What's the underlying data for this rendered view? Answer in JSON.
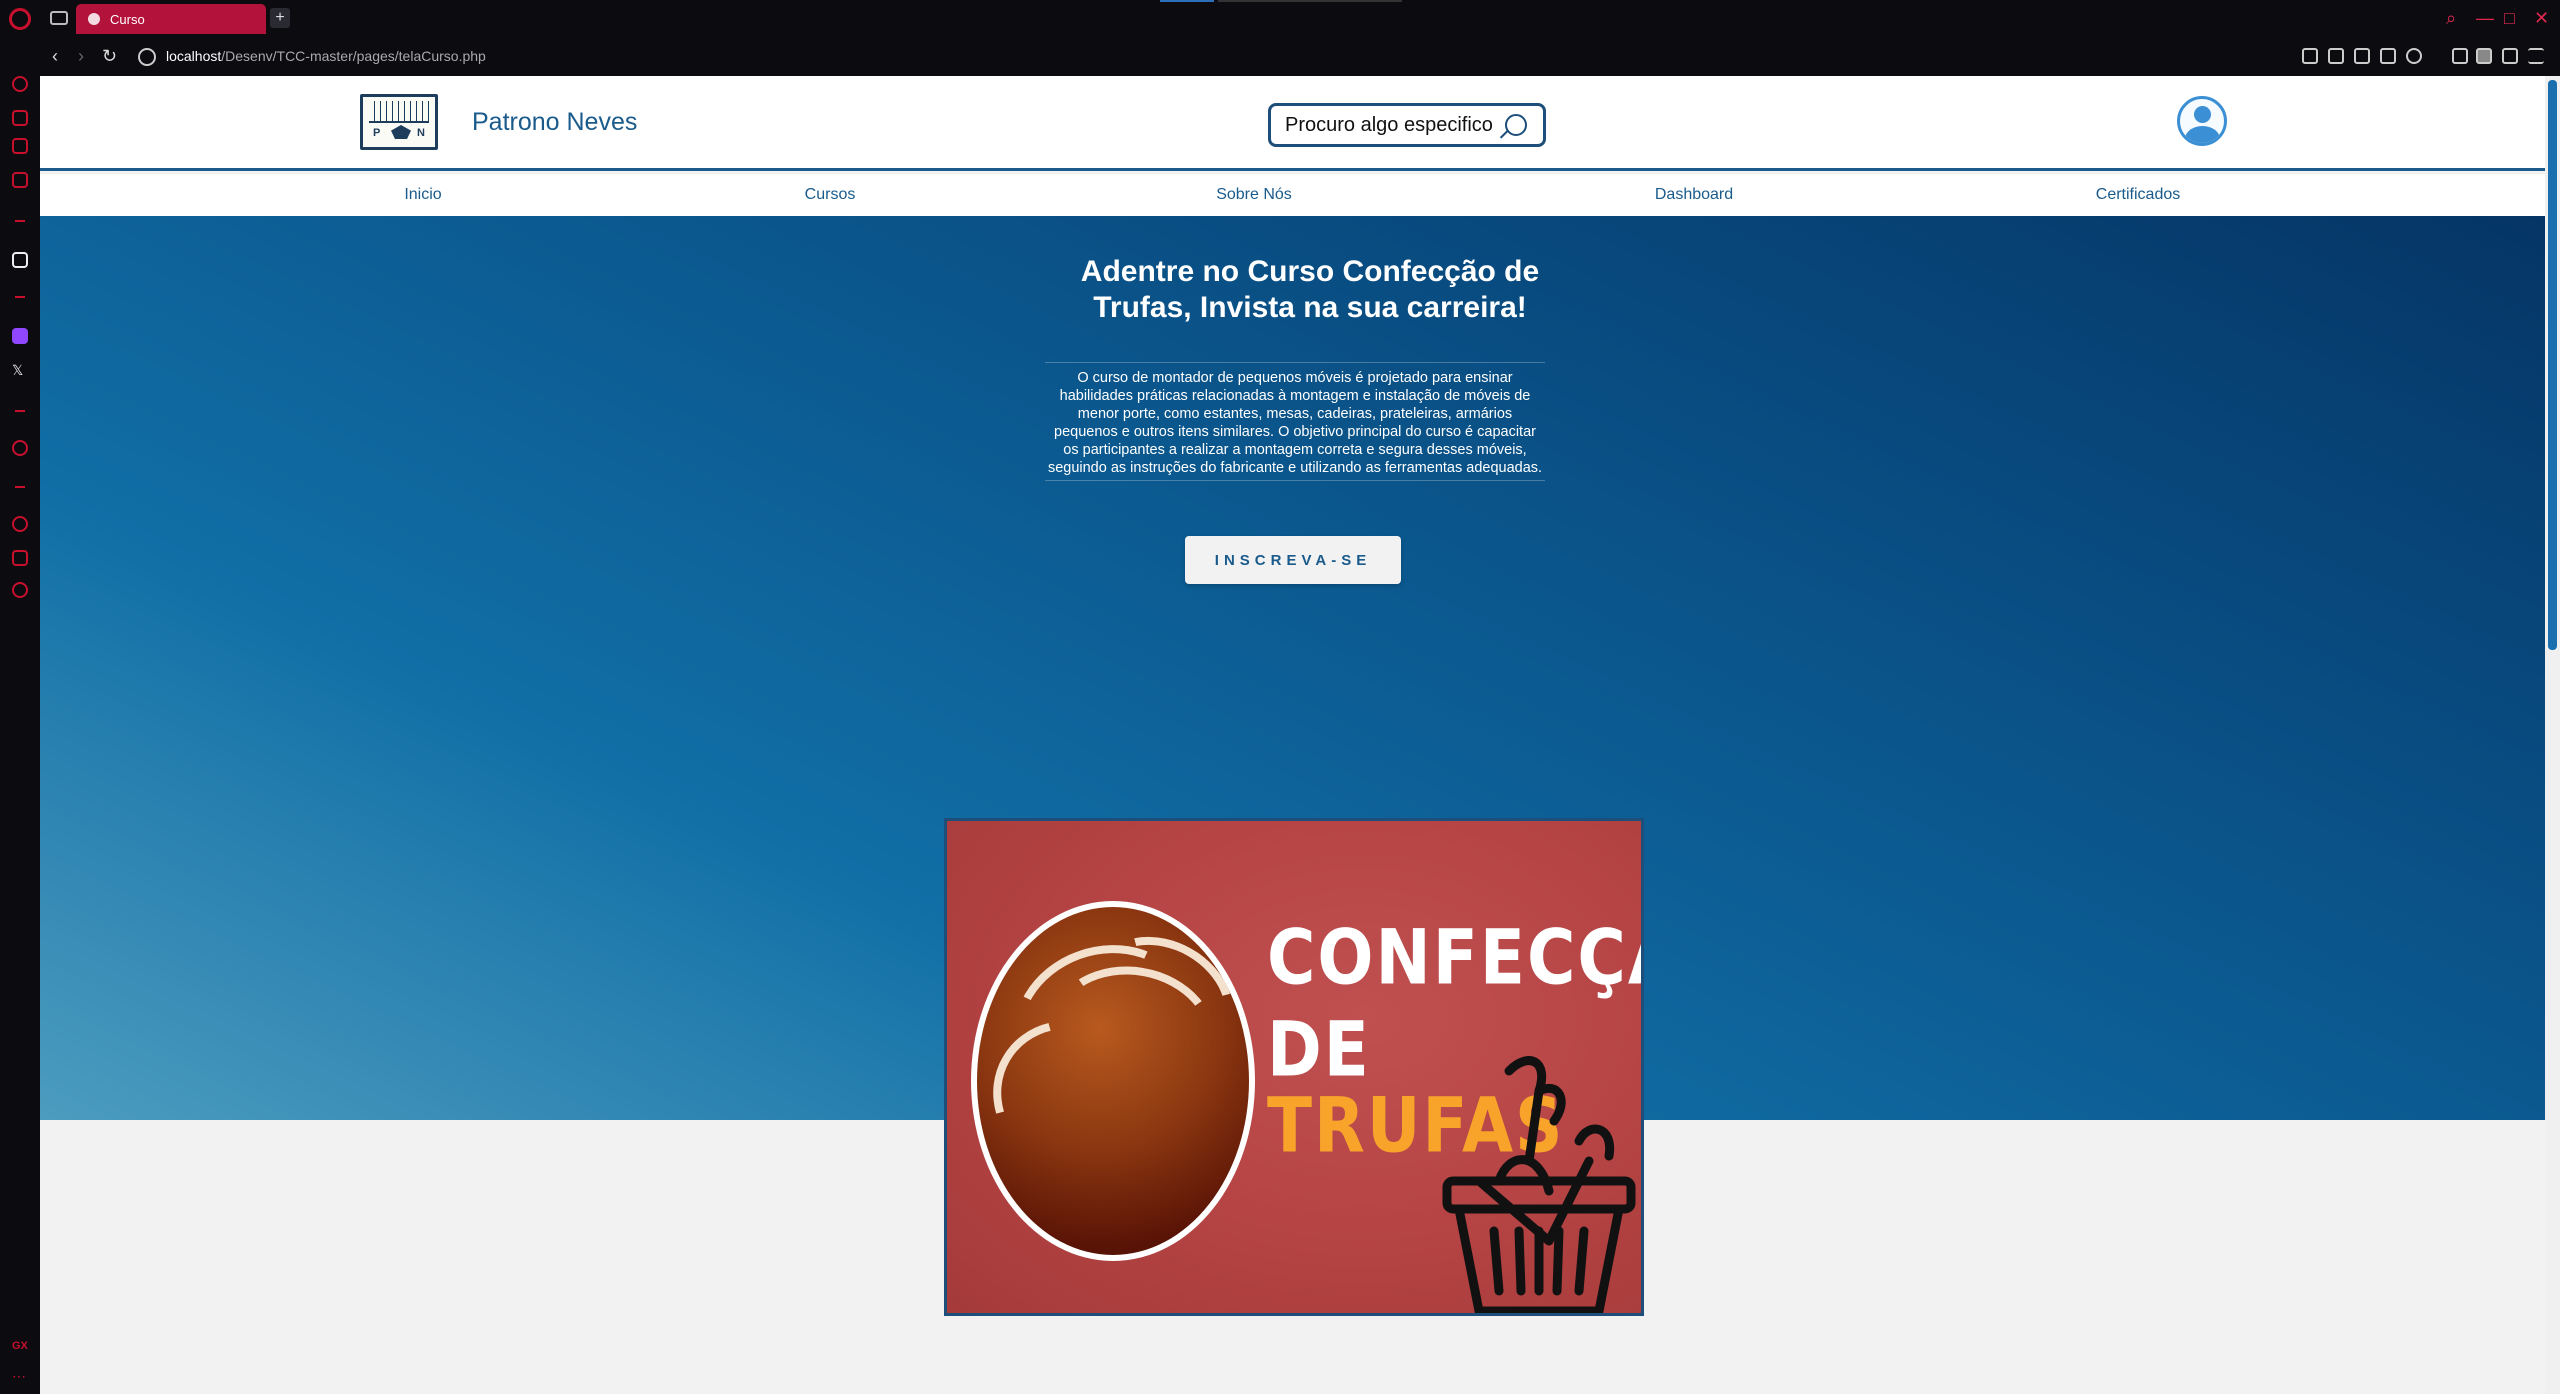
{
  "browser": {
    "tab_title": "Curso",
    "url_host": "localhost",
    "url_path": "/Desenv/TCC-master/pages/telaCurso.php",
    "new_tab_symbol": "+"
  },
  "site": {
    "brand": "Patrono Neves",
    "logo_letters": [
      "P",
      "N"
    ],
    "search_placeholder": "Procuro algo especifico",
    "nav": [
      "Inicio",
      "Cursos",
      "Sobre Nós",
      "Dashboard",
      "Certificados"
    ]
  },
  "hero": {
    "title": "Adentre no Curso Confecção de Trufas, Invista na sua carreira!",
    "description": "O curso de montador de pequenos móveis é projetado para ensinar habilidades práticas relacionadas à montagem e instalação de móveis de menor porte, como estantes, mesas, cadeiras, prateleiras, armários pequenos e outros itens similares. O objetivo principal do curso é capacitar os participantes a realizar a montagem correta e segura desses móveis, seguindo as instruções do fabricante e utilizando as ferramentas adequadas.",
    "button": "INSCREVA-SE"
  },
  "course_image": {
    "line1": "CONFECÇÃO",
    "line2": "DE",
    "line3": "TRUFAS"
  },
  "colors": {
    "accent": "#1a5b8c",
    "opera_red": "#c8102e",
    "tab_active": "#b3123a",
    "image_bg": "#b64444",
    "trufas_orange": "#f8a42a"
  }
}
